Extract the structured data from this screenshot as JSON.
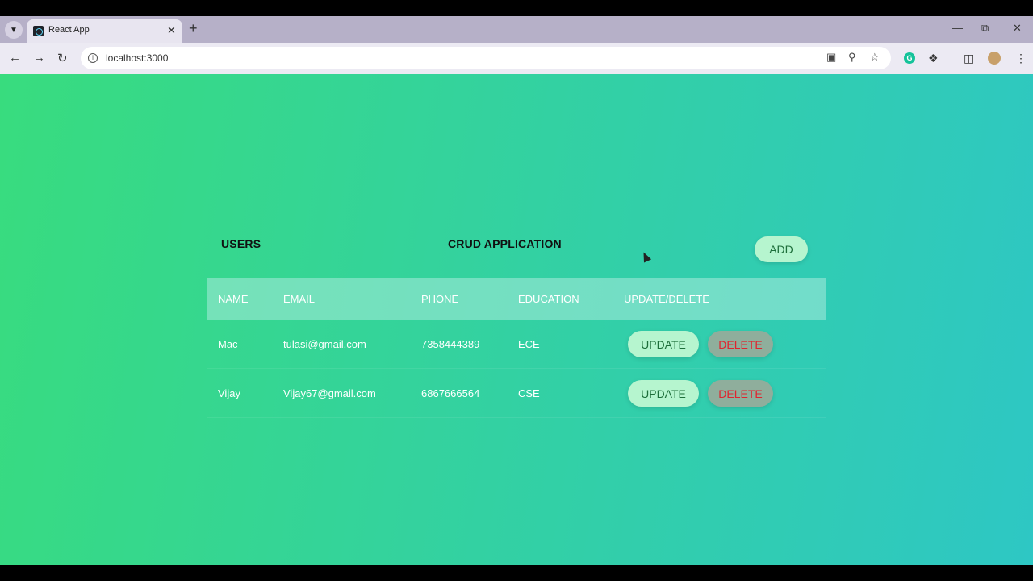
{
  "browser": {
    "tab_title": "React App",
    "url": "localhost:3000",
    "icons": {
      "tab_search": "chevron-down-icon",
      "favicon": "react-icon",
      "tab_close": "close-icon",
      "new_tab": "plus-icon",
      "back": "arrow-left-icon",
      "forward": "arrow-right-icon",
      "reload": "reload-icon",
      "site_info": "info-icon",
      "install": "install-icon",
      "zoom": "zoom-icon",
      "bookmark": "star-icon",
      "grammarly": "grammarly-icon",
      "extensions": "puzzle-icon",
      "side_panel": "side-panel-icon",
      "profile": "avatar",
      "menu": "kebab-menu-icon"
    }
  },
  "page": {
    "users_heading": "USERS",
    "app_heading": "CRUD APPLICATION",
    "add_label": "ADD"
  },
  "table": {
    "headers": [
      "NAME",
      "EMAIL",
      "PHONE",
      "EDUCATION",
      "UPDATE/DELETE"
    ],
    "rows": [
      {
        "name": "Mac",
        "email": "tulasi@gmail.com",
        "phone": "7358444389",
        "education": "ECE",
        "update_label": "UPDATE",
        "delete_label": "DELETE"
      },
      {
        "name": "Vijay",
        "email": "Vijay67@gmail.com",
        "phone": "6867666564",
        "education": "CSE",
        "update_label": "UPDATE",
        "delete_label": "DELETE"
      }
    ]
  },
  "colors": {
    "gradient_start": "#38dc7e",
    "gradient_end": "#2ec7c4",
    "button_green": "#b6f5cf",
    "delete_text": "#e0242e"
  }
}
